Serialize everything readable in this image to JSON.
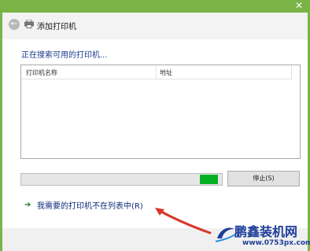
{
  "window": {
    "close_glyph": "✕"
  },
  "header": {
    "back_icon": "back-arrow-icon",
    "printer_icon": "printer-icon",
    "title": "添加打印机"
  },
  "main": {
    "status_text": "正在搜索可用的打印机...",
    "list": {
      "columns": [
        "打印机名称",
        "地址"
      ],
      "rows": []
    },
    "progress": {
      "fill_start_fraction": 0.89,
      "fill_end_fraction": 0.98,
      "color": "#06b025"
    },
    "stop_button_label": "停止(S)",
    "not_listed_link": "我需要的打印机不在列表中(R)"
  },
  "watermark": {
    "title": "鹏鑫装机网",
    "url": "www.0753px.com"
  },
  "colors": {
    "accent_green": "#7ab446",
    "link_blue": "#0b2a7a",
    "annotation_red": "#d8362b"
  }
}
